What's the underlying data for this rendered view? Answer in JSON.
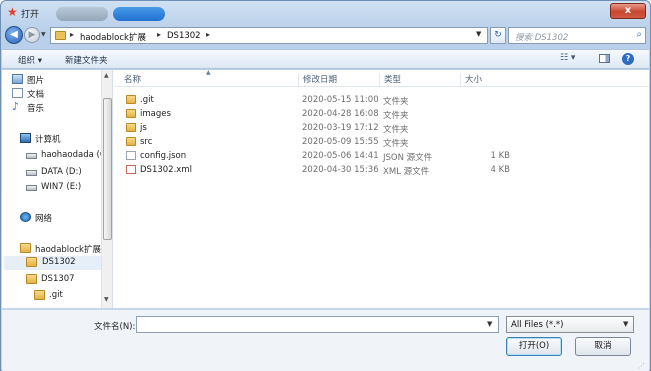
{
  "window": {
    "title": "打开",
    "blurred_tabs": [
      "",
      ""
    ],
    "close_label": "x"
  },
  "nav": {
    "back_arrow": "◀",
    "forward_arrow": "▶",
    "breadcrumb": [
      "haodablock扩展",
      "DS1302"
    ],
    "refresh_icon": "refresh-icon",
    "search_placeholder": "搜索 DS1302"
  },
  "toolbar": {
    "organize": "组织 ▾",
    "new_folder": "新建文件夹"
  },
  "sidebar": {
    "items": [
      {
        "label": "图片",
        "icon": "pictures-icon"
      },
      {
        "label": "文档",
        "icon": "documents-icon"
      },
      {
        "label": "音乐",
        "icon": "music-icon"
      },
      {
        "label": "计算机",
        "icon": "computer-icon"
      },
      {
        "label": "haohaodada (C",
        "icon": "drive-icon"
      },
      {
        "label": "DATA (D:)",
        "icon": "drive-icon"
      },
      {
        "label": "WIN7 (E:)",
        "icon": "drive-icon"
      },
      {
        "label": "网络",
        "icon": "network-icon"
      },
      {
        "label": "haodablock扩展",
        "icon": "folder-icon"
      },
      {
        "label": "DS1302",
        "icon": "folder-icon",
        "selected": true
      },
      {
        "label": "DS1307",
        "icon": "folder-icon"
      },
      {
        "label": ".git",
        "icon": "folder-icon"
      }
    ]
  },
  "files": {
    "columns": [
      "名称",
      "修改日期",
      "类型",
      "大小"
    ],
    "rows": [
      {
        "name": ".git",
        "date": "2020-05-15 11:00",
        "type": "文件夹",
        "size": "",
        "icon": "folder-icon"
      },
      {
        "name": "images",
        "date": "2020-04-28 16:08",
        "type": "文件夹",
        "size": "",
        "icon": "folder-icon"
      },
      {
        "name": "js",
        "date": "2020-03-19 17:12",
        "type": "文件夹",
        "size": "",
        "icon": "folder-icon"
      },
      {
        "name": "src",
        "date": "2020-05-09 15:55",
        "type": "文件夹",
        "size": "",
        "icon": "folder-icon"
      },
      {
        "name": "config.json",
        "date": "2020-05-06 14:41",
        "type": "JSON 源文件",
        "size": "1 KB",
        "icon": "file-icon"
      },
      {
        "name": "DS1302.xml",
        "date": "2020-04-30 15:36",
        "type": "XML 源文件",
        "size": "4 KB",
        "icon": "xml-file-icon"
      }
    ]
  },
  "footer": {
    "filename_label": "文件名(N):",
    "filename_value": "",
    "file_type": "All Files (*.*)",
    "open_button": "打开(O)",
    "cancel_button": "取消"
  }
}
